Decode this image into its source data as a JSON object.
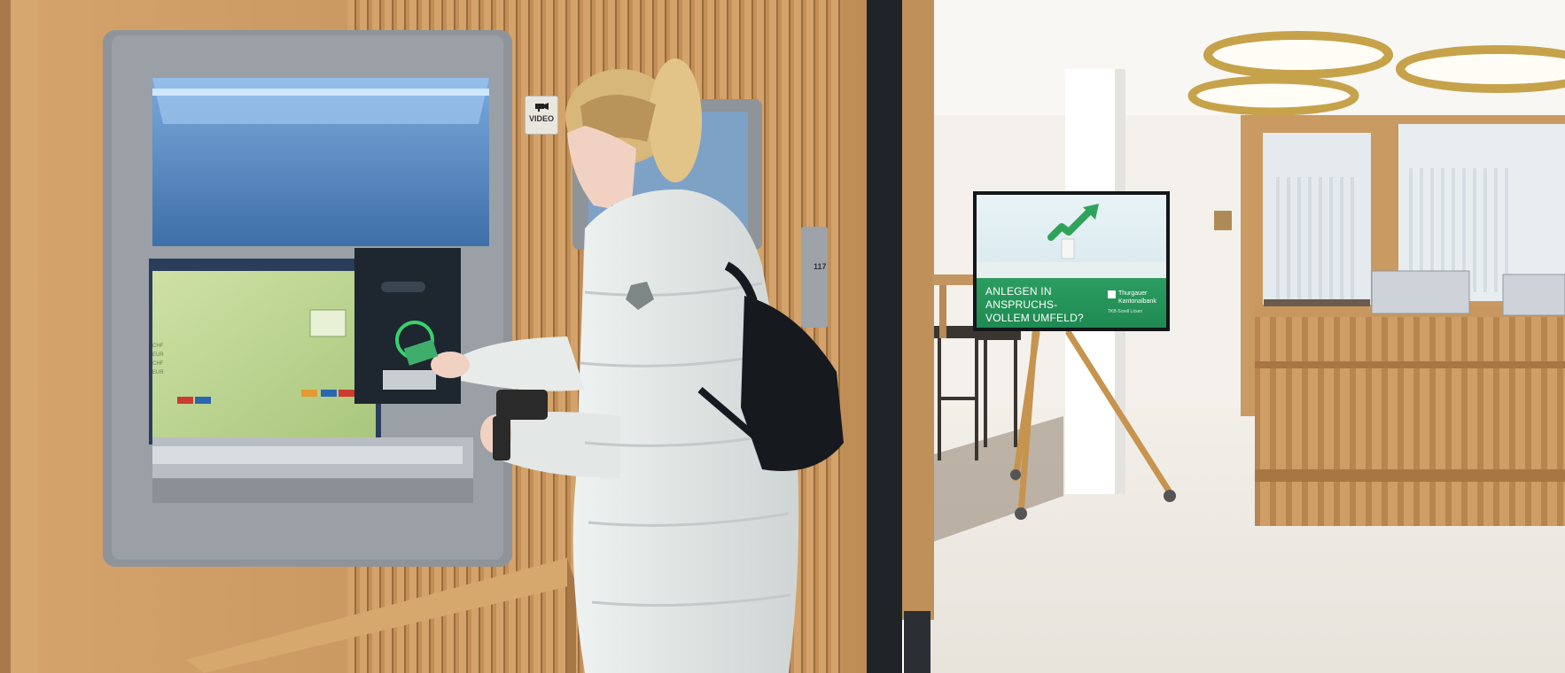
{
  "scene": {
    "description_labels": {
      "video_sign": "VIDEO",
      "door_number": "117"
    },
    "screen": {
      "headline_line1": "ANLEGEN IN ANSPRUCHS-",
      "headline_line2": "VOLLEM UMFELD?",
      "logo_line1": "Thurgauer",
      "logo_line2": "Kantonalbank",
      "logo_sub": "TKB-Sorell Lösen"
    },
    "atm_screen": {
      "currency_lines": [
        "CHF",
        "EUR",
        "CHF",
        "EUR"
      ]
    }
  },
  "colors": {
    "wood": "#c99a63",
    "atm_frame": "#8e949a",
    "atm_blue": "#5f8fc4",
    "screen_green": "#2fa35a",
    "coat": "#dfe4e3"
  }
}
